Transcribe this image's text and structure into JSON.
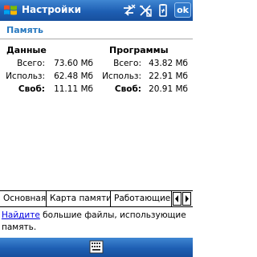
{
  "window": {
    "title": "Настройки",
    "ok_label": "ok"
  },
  "page": {
    "header": "Память"
  },
  "columns": [
    {
      "title": "Данные",
      "rows": [
        {
          "label": "Всего:",
          "value": "73.60 Мб",
          "bold": false
        },
        {
          "label": "Использ:",
          "value": "62.48 Мб",
          "bold": false
        },
        {
          "label": "Своб:",
          "value": "11.11 Мб",
          "bold": true
        }
      ]
    },
    {
      "title": "Программы",
      "rows": [
        {
          "label": "Всего:",
          "value": "43.82 Мб",
          "bold": false
        },
        {
          "label": "Использ:",
          "value": "22.91 Мб",
          "bold": false
        },
        {
          "label": "Своб:",
          "value": "20.91 Мб",
          "bold": true
        }
      ]
    }
  ],
  "tabs": [
    "Основная",
    "Карта памяти",
    "Работающие"
  ],
  "footer": {
    "link": "Найдите",
    "text": " большие файлы, использующие память."
  },
  "colors": {
    "titlebar": "#1e5fb3",
    "header_text": "#2a7ac0",
    "link": "#0000e0"
  },
  "icons": [
    "windows-start-icon",
    "connectivity-icon",
    "no-signal-icon",
    "battery-icon",
    "keyboard-icon"
  ]
}
